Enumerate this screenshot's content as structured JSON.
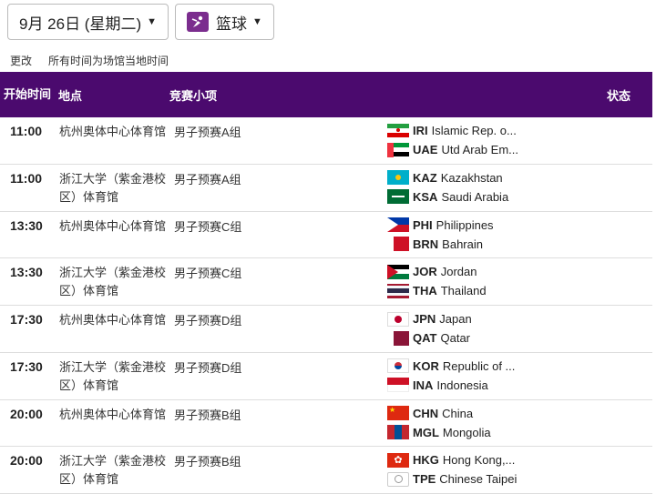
{
  "header": {
    "date_label": "9月 26日 (星期二)",
    "sport_label": "篮球",
    "change_link": "更改",
    "timezone_note": "所有时间为场馆当地时间"
  },
  "columns": {
    "time": "开始时间",
    "venue": "地点",
    "event": "竞赛小项",
    "status": "状态"
  },
  "rows": [
    {
      "time": "11:00",
      "venue": "杭州奥体中心体育馆",
      "event": "男子预赛A组",
      "teams": [
        {
          "flag": "iran",
          "code": "IRI",
          "name": "Islamic Rep. o..."
        },
        {
          "flag": "uae",
          "code": "UAE",
          "name": "Utd Arab Em..."
        }
      ]
    },
    {
      "time": "11:00",
      "venue": "浙江大学（紫金港校区）体育馆",
      "event": "男子预赛A组",
      "teams": [
        {
          "flag": "kazakhstan",
          "code": "KAZ",
          "name": "Kazakhstan"
        },
        {
          "flag": "saudi",
          "code": "KSA",
          "name": "Saudi Arabia"
        }
      ]
    },
    {
      "time": "13:30",
      "venue": "杭州奥体中心体育馆",
      "event": "男子预赛C组",
      "teams": [
        {
          "flag": "philippines",
          "code": "PHI",
          "name": "Philippines"
        },
        {
          "flag": "bahrain",
          "code": "BRN",
          "name": "Bahrain"
        }
      ]
    },
    {
      "time": "13:30",
      "venue": "浙江大学（紫金港校区）体育馆",
      "event": "男子预赛C组",
      "teams": [
        {
          "flag": "jordan",
          "code": "JOR",
          "name": "Jordan"
        },
        {
          "flag": "thailand",
          "code": "THA",
          "name": "Thailand"
        }
      ]
    },
    {
      "time": "17:30",
      "venue": "杭州奥体中心体育馆",
      "event": "男子预赛D组",
      "teams": [
        {
          "flag": "japan",
          "code": "JPN",
          "name": "Japan"
        },
        {
          "flag": "qatar",
          "code": "QAT",
          "name": "Qatar"
        }
      ]
    },
    {
      "time": "17:30",
      "venue": "浙江大学（紫金港校区）体育馆",
      "event": "男子预赛D组",
      "teams": [
        {
          "flag": "korea",
          "code": "KOR",
          "name": "Republic of ..."
        },
        {
          "flag": "indonesia",
          "code": "INA",
          "name": "Indonesia"
        }
      ]
    },
    {
      "time": "20:00",
      "venue": "杭州奥体中心体育馆",
      "event": "男子预赛B组",
      "teams": [
        {
          "flag": "china",
          "code": "CHN",
          "name": "China"
        },
        {
          "flag": "mongolia",
          "code": "MGL",
          "name": "Mongolia"
        }
      ]
    },
    {
      "time": "20:00",
      "venue": "浙江大学（紫金港校区）体育馆",
      "event": "男子预赛B组",
      "teams": [
        {
          "flag": "hongkong",
          "code": "HKG",
          "name": "Hong Kong,..."
        },
        {
          "flag": "chinese-taipei",
          "code": "TPE",
          "name": "Chinese Taipei"
        }
      ]
    }
  ],
  "colors": {
    "header_bg": "#4b0a6e",
    "sport_icon": "#7b2d8e"
  }
}
